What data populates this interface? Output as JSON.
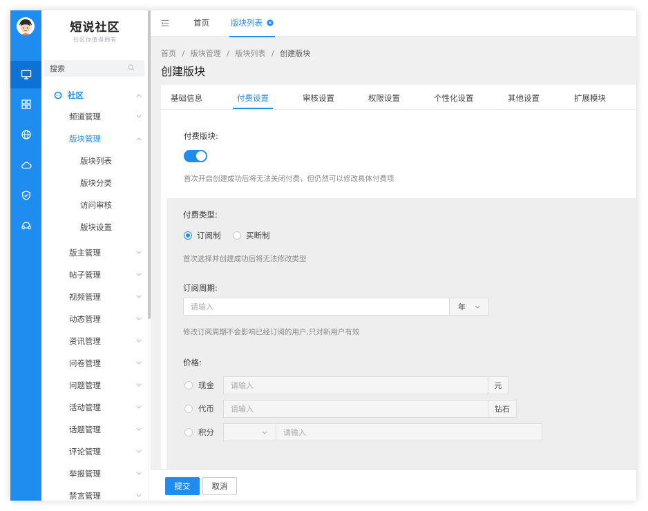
{
  "app": {
    "logo_title": "短说社区",
    "logo_slogan": "社区你值得拥有"
  },
  "sidebar": {
    "search_placeholder": "搜索",
    "section_label": "社区",
    "items": [
      {
        "label": "频道管理",
        "level": 1,
        "expanded": false
      },
      {
        "label": "版块管理",
        "level": 1,
        "expanded": true
      },
      {
        "label": "版块列表",
        "level": 2
      },
      {
        "label": "版块分类",
        "level": 2
      },
      {
        "label": "访问审核",
        "level": 2
      },
      {
        "label": "版块设置",
        "level": 2
      },
      {
        "label": "版主管理",
        "level": 1
      },
      {
        "label": "帖子管理",
        "level": 1
      },
      {
        "label": "视频管理",
        "level": 1
      },
      {
        "label": "动态管理",
        "level": 1
      },
      {
        "label": "资讯管理",
        "level": 1
      },
      {
        "label": "问卷管理",
        "level": 1
      },
      {
        "label": "问题管理",
        "level": 1
      },
      {
        "label": "活动管理",
        "level": 1
      },
      {
        "label": "话题管理",
        "level": 1
      },
      {
        "label": "评论管理",
        "level": 1
      },
      {
        "label": "举报管理",
        "level": 1
      },
      {
        "label": "禁言管理",
        "level": 1
      }
    ]
  },
  "topbar": {
    "tabs": [
      {
        "label": "首页",
        "active": false
      },
      {
        "label": "版块列表",
        "active": true
      }
    ]
  },
  "breadcrumb": {
    "items": [
      "首页",
      "版块管理",
      "版块列表",
      "创建版块"
    ],
    "separator": "/"
  },
  "page_title": "创建版块",
  "form_tabs": [
    "基础信息",
    "付费设置",
    "审核设置",
    "权限设置",
    "个性化设置",
    "其他设置",
    "扩展模块"
  ],
  "active_form_tab": "付费设置",
  "paid": {
    "label": "付费版块:",
    "enabled": true,
    "hint": "首次开启创建成功后将无法关闭付费，但仍然可以修改具体付费项"
  },
  "pay_type": {
    "label": "付费类型:",
    "options": [
      "订阅制",
      "买断制"
    ],
    "selected": "订阅制",
    "hint": "首次选择并创建成功后将无法修改类型"
  },
  "period": {
    "label": "订阅周期:",
    "placeholder": "请输入",
    "unit": "年",
    "hint": "修改订阅周期不会影响已经订阅的用户,只对新用户有效"
  },
  "price": {
    "label": "价格:",
    "rows": [
      {
        "label": "现金",
        "placeholder": "请输入",
        "unit": "元"
      },
      {
        "label": "代币",
        "placeholder": "请输入",
        "unit": "钻石"
      },
      {
        "label": "积分",
        "placeholder": "请输入",
        "unit": ""
      }
    ]
  },
  "footer": {
    "submit": "提交",
    "cancel": "取消"
  },
  "colors": {
    "primary": "#1f8cf0",
    "rail": "#1f8cf0",
    "rail_active": "#0d72d4"
  }
}
